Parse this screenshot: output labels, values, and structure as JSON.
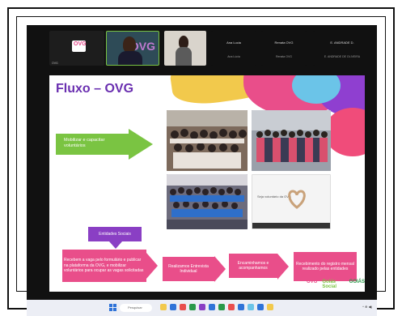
{
  "meeting": {
    "tiles": [
      {
        "name": "OVG",
        "logo": "OVG"
      },
      {
        "name": "",
        "bg_logo": "OVG"
      },
      {
        "name": ""
      }
    ],
    "participants": [
      {
        "top": "Ana Lucia",
        "bottom": "Ana Lúcia"
      },
      {
        "top": "Renata OVG",
        "bottom": "Renata OVG"
      },
      {
        "top": "E. ANDRADE D.",
        "bottom": "E. ANDRADE DE OLIVEIRA"
      }
    ]
  },
  "slide": {
    "title": "Fluxo – OVG",
    "green_step": "Mobilizar e capacitar voluntários",
    "entities": "Entidades Sociais",
    "steps": [
      "Recebem a vaga pelo formulário e publicar na plataforma da OVG, e mobilizar voluntários para ocupar as vagas solicitadas",
      "Realizamos Entrevista Individual",
      "Encaminhamos e acompanhamos",
      "Recebimento do registro mensal realizado pelas entidades"
    ],
    "photo4_text": "Seja voluntário da OVG",
    "logos": [
      "OVG",
      "Goiás Social",
      "GOIÁS"
    ]
  },
  "taskbar": {
    "search_placeholder": "Pesquisar",
    "tray": "^ ⊕ ◀)"
  },
  "colors": {
    "pink": "#e94e8a",
    "green": "#7ac442",
    "purple": "#8a3fc4",
    "title": "#6a2fb0"
  }
}
